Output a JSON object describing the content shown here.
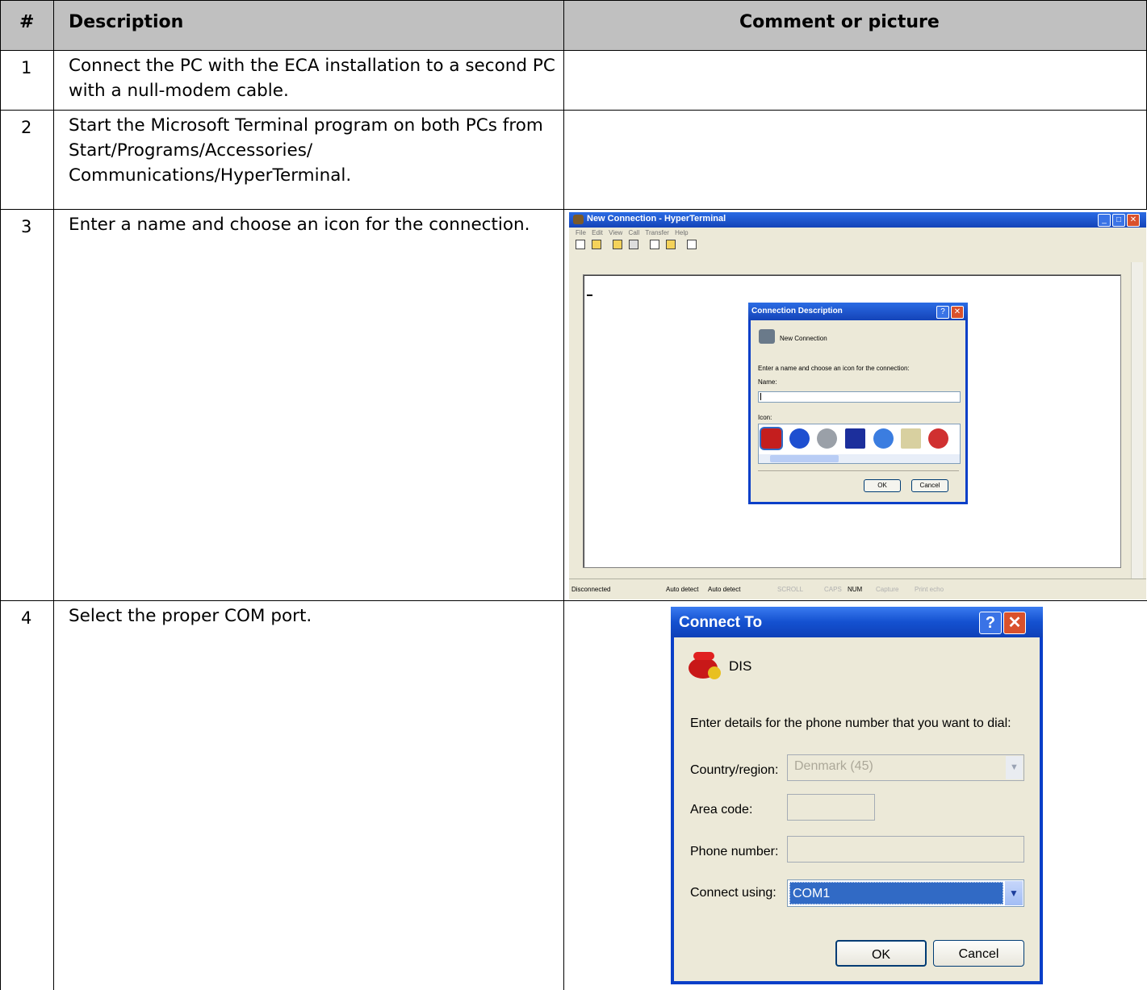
{
  "table": {
    "headers": {
      "num": "#",
      "description": "Description",
      "comment": "Comment or picture"
    },
    "rows": [
      {
        "num": "1",
        "description": "Connect the PC with the ECA installation to a second PC with a null-modem cable."
      },
      {
        "num": "2",
        "description": "Start the Microsoft Terminal program on both PCs from Start/Programs/Accessories/ Communications/HyperTerminal."
      },
      {
        "num": "3",
        "description": "Enter a name and choose an icon for the connection."
      },
      {
        "num": "4",
        "description": "Select the proper COM port."
      }
    ]
  },
  "hyperterminal": {
    "title": "New Connection - HyperTerminal",
    "menu": "File  Edit  View  Call  Transfer  Help",
    "status": [
      "Disconnected",
      "Auto detect",
      "Auto detect",
      "SCROLL",
      "CAPS",
      "NUM",
      "Capture",
      "Print echo"
    ],
    "dialog": {
      "title": "Connection Description",
      "connection_name": "New Connection",
      "prompt": "Enter a name and choose an icon for the connection:",
      "name_label": "Name:",
      "icon_label": "Icon:",
      "ok": "OK",
      "cancel": "Cancel",
      "icons": [
        "phone-red-icon",
        "globe-blue-icon",
        "phone-gray-icon",
        "mci-icon",
        "globe-icon",
        "doc-icon",
        "pin-icon"
      ]
    }
  },
  "connect_to": {
    "title": "Connect To",
    "help": "?",
    "close": "✕",
    "connection_name": "DIS",
    "prompt": "Enter details for the phone number that you want to dial:",
    "country_label": "Country/region:",
    "country_value": "Denmark (45)",
    "area_label": "Area code:",
    "area_value": "",
    "phone_label": "Phone number:",
    "phone_value": "",
    "connect_label": "Connect using:",
    "connect_value": "COM1",
    "ok": "OK",
    "cancel": "Cancel"
  },
  "colors": {
    "header_bg": "#c0c0c0",
    "xp_title": "#1451d0",
    "xp_close": "#d9512c",
    "selection": "#316ac5"
  }
}
